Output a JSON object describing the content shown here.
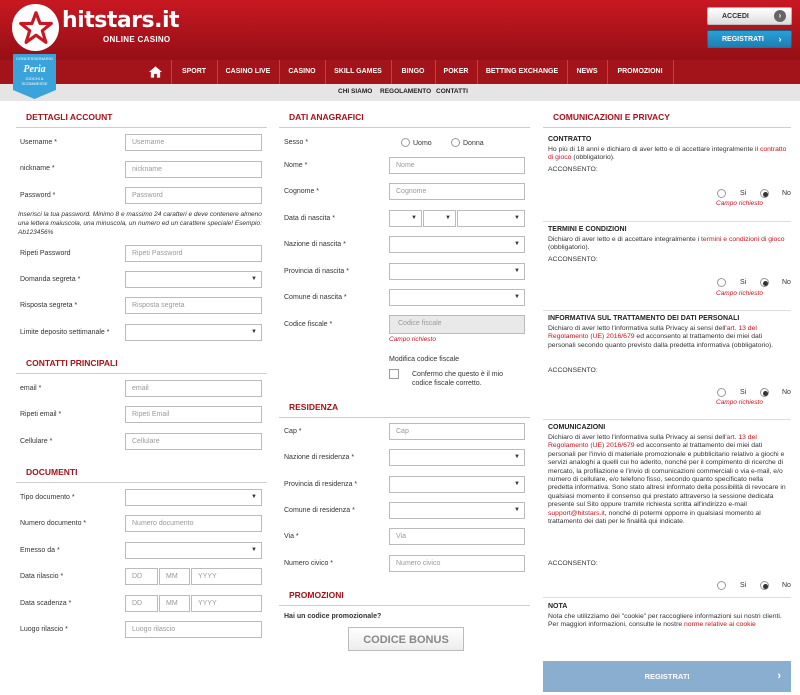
{
  "header": {
    "brand": "hitstars.it",
    "brand_sub": "ONLINE CASINO",
    "login": "ACCEDI",
    "register": "REGISTRATI",
    "badge": {
      "line1": "CONCESSIONARIO",
      "name": "Peria",
      "line2": "GIOCHI & SCOMMESSE"
    }
  },
  "nav": [
    "SPORT",
    "CASINO LIVE",
    "CASINO",
    "SKILL GAMES",
    "BINGO",
    "POKER",
    "BETTING EXCHANGE",
    "NEWS",
    "PROMOZIONI"
  ],
  "subnav": [
    "CHI SIAMO",
    "REGOLAMENTO",
    "CONTATTI"
  ],
  "account": {
    "title": "DETTAGLI ACCOUNT",
    "username_label": "Username *",
    "username_ph": "Username",
    "nickname_label": "nickname *",
    "nickname_ph": "nickname",
    "password_label": "Password *",
    "password_ph": "Password",
    "password_hint": "Inserisci la tua password. Minimo 8 e massimo 24 caratteri e deve contenere almeno una lettera maiuscola, una minuscola, un numero ed un carattere speciale! Esempio: Ab123456%",
    "repeat_label": "Ripeti Password",
    "repeat_ph": "Ripeti Password",
    "question_label": "Domanda segreta *",
    "answer_label": "Risposta segreta *",
    "answer_ph": "Risposta segreta",
    "limit_label": "Limite deposito settimanale *"
  },
  "contacts": {
    "title": "CONTATTI PRINCIPALI",
    "email_label": "email *",
    "email_ph": "email",
    "repeat_email_label": "Ripeti email *",
    "repeat_email_ph": "Ripeti Email",
    "phone_label": "Cellulare *",
    "phone_ph": "Cellulare"
  },
  "documents": {
    "title": "DOCUMENTI",
    "type_label": "Tipo documento *",
    "number_label": "Numero documento *",
    "number_ph": "Numero documento",
    "issuer_label": "Emesso da *",
    "issue_label": "Data rilascio *",
    "expiry_label": "Data scadenza *",
    "place_label": "Luogo rilascio *",
    "place_ph": "Luogo rilascio",
    "dd": "DD",
    "mm": "MM",
    "yyyy": "YYYY"
  },
  "personal": {
    "title": "DATI ANAGRAFICI",
    "sex_label": "Sesso *",
    "male": "Uomo",
    "female": "Donna",
    "name_label": "Nome *",
    "name_ph": "Nome",
    "surname_label": "Cognome *",
    "surname_ph": "Cognome",
    "birthdate_label": "Data di nascita *",
    "birthnation_label": "Nazione di nascita *",
    "birthprov_label": "Provincia di nascita *",
    "birthcity_label": "Comune di nascita *",
    "fiscal_label": "Codice fiscale *",
    "fiscal_ph": "Codice fiscale",
    "required": "Campo richiesto",
    "edit_fiscal": "Modifica codice fiscale",
    "confirm_fiscal": "Confermo che questo è il mio codice fiscale corretto."
  },
  "residence": {
    "title": "RESIDENZA",
    "cap_label": "Cap *",
    "cap_ph": "Cap",
    "nation_label": "Nazione di residenza *",
    "prov_label": "Provincia di residenza *",
    "city_label": "Comune di residenza *",
    "street_label": "Via *",
    "street_ph": "Via",
    "civic_label": "Numero civico *",
    "civic_ph": "Numero civico"
  },
  "promo": {
    "title": "PROMOZIONI",
    "question": "Hai un codice promozionale?",
    "button": "CODICE BONUS"
  },
  "privacy": {
    "title": "COMUNICAZIONI E PRIVACY",
    "yes": "Si",
    "no": "No",
    "required": "Campo richiesto",
    "consent": "ACCONSENTO:",
    "contract_title": "CONTRATTO",
    "contract_text_a": "Ho più di 18 anni e dichiaro di aver letto e di accettare integralmente il ",
    "contract_link": "contratto di gioco",
    "contract_text_b": " (obbligatorio).",
    "terms_title": "TERMINI E CONDIZIONI",
    "terms_text_a": "Dichiaro di aver letto e di accettare integralmente i ",
    "terms_link": "termini e condizioni di gioco",
    "terms_text_b": " (obbligatorio).",
    "info_title": "INFORMATIVA SUL TRATTAMENTO DEI DATI PERSONALI",
    "info_text_a": "Dichiaro di aver letto l'informativa sulla Privacy ai sensi dell'",
    "info_link": "art. 13 del Regolamento (UE) 2016/679",
    "info_text_b": " ed acconsento al trattamento dei miei dati personali secondo quanto previsto dalla predetta informativa (obbligatorio).",
    "comm_title": "COMUNICAZIONI",
    "comm_text_a": "Dichiaro di aver letto l'informativa sulla Privacy ai sensi dell'",
    "comm_link": "art. 13 del Regolamento (UE) 2016/679",
    "comm_text_b": " ed acconsento al trattamento dei miei dati personali per l'invio di materiale promozionale e pubblicitario relativo a giochi e servizi analoghi a quelli cui ho aderito, nonché per il compimento di ricerche di mercato, la profilazione e l'invio di comunicazioni commerciali o via e-mail, e/o numero di cellulare, e/o telefono fisso, secondo quanto specificato nella predetta informativa. Sono stato altresì informato della possibilità di revocare in qualsiasi momento il consenso qui prestato attraverso la sessione dedicata presente sul Sito oppure tramite richiesta scritta all'indirizzo e-mail ",
    "comm_email": "support@hitstars.it",
    "comm_text_c": ", nonché di potermi opporre in qualsiasi momento al trattamento dei dati per le finalità qui indicate.",
    "note_title": "NOTA",
    "note_text_a": "Nota che utilizziamo dei \"cookie\" per raccogliere informazioni sui nostri clienti. Per maggiori informazioni, consulte le nostre ",
    "note_link": "norme relative ai cookie",
    "register": "REGISTRATI"
  }
}
